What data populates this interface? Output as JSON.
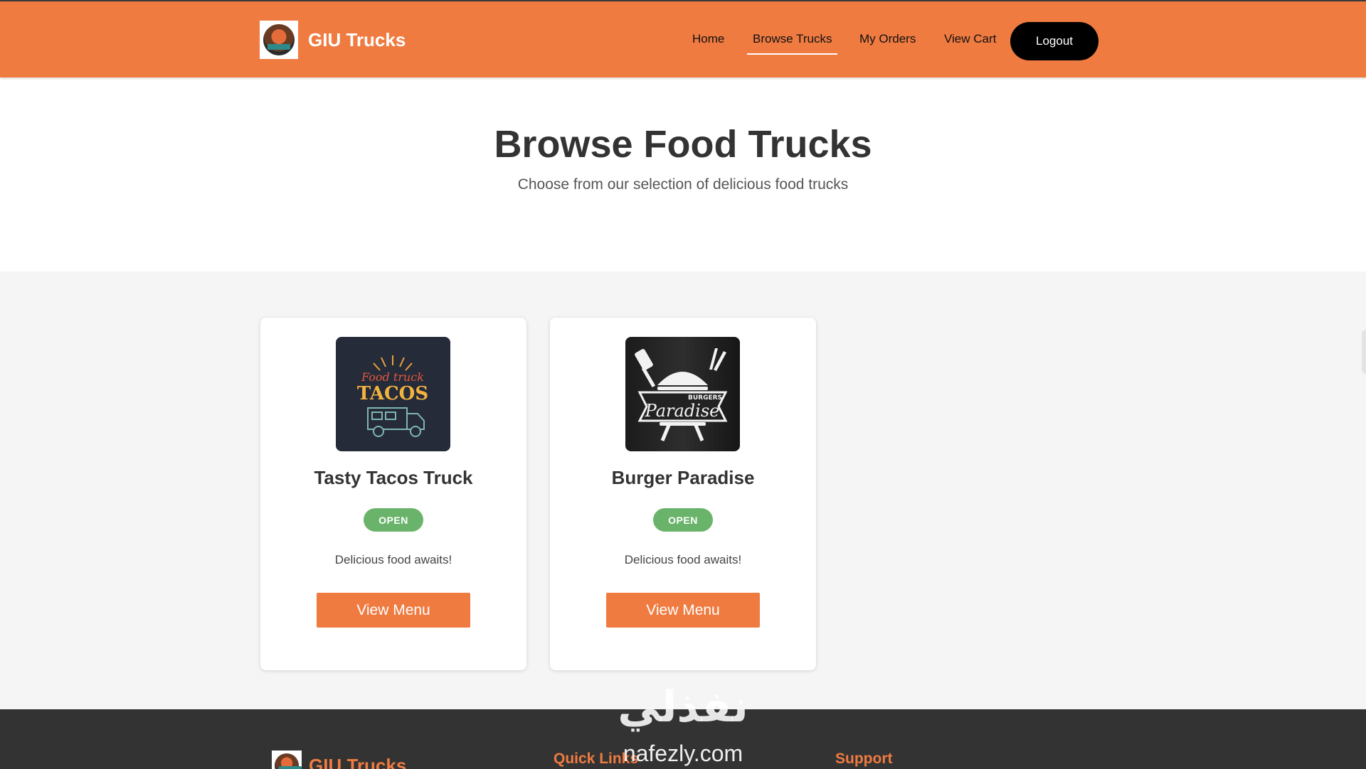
{
  "header": {
    "brand_name": "GIU Trucks",
    "nav": [
      {
        "label": "Home"
      },
      {
        "label": "Browse Trucks"
      },
      {
        "label": "My Orders"
      },
      {
        "label": "View Cart"
      }
    ],
    "logout_label": "Logout"
  },
  "hero": {
    "title": "Browse Food Trucks",
    "subtitle": "Choose from our selection of delicious food trucks"
  },
  "trucks": [
    {
      "name": "Tasty Tacos Truck",
      "status": "OPEN",
      "description": "Delicious food awaits!",
      "button_label": "View Menu",
      "image_text_1": "Food truck",
      "image_text_2": "TACOS"
    },
    {
      "name": "Burger Paradise",
      "status": "OPEN",
      "description": "Delicious food awaits!",
      "button_label": "View Menu",
      "image_text_1": "BURGERS",
      "image_text_2": "Paradise"
    }
  ],
  "footer": {
    "brand_name": "GIU Trucks",
    "quick_links_heading": "Quick Links",
    "support_heading": "Support"
  },
  "watermark": {
    "arabic": "نفذلي",
    "latin": "nafezly.com"
  },
  "colors": {
    "accent": "#ef7b41",
    "dark": "#333333",
    "open_badge": "#6ab36a"
  }
}
